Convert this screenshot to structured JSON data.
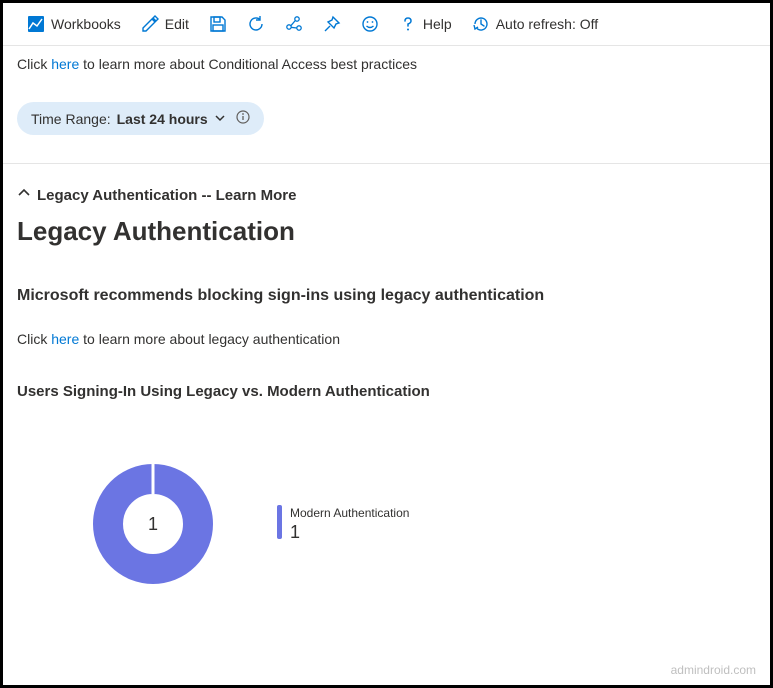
{
  "toolbar": {
    "workbooks": "Workbooks",
    "edit": "Edit",
    "help": "Help",
    "auto_refresh": "Auto refresh: Off"
  },
  "info_line": {
    "pre": "Click ",
    "link": "here",
    "post": " to learn more about Conditional Access best practices"
  },
  "time_range": {
    "label": "Time Range: ",
    "value": "Last 24 hours"
  },
  "section": {
    "expander_label": "Legacy Authentication -- Learn More",
    "title": "Legacy Authentication",
    "subtitle": "Microsoft recommends blocking sign-ins using legacy authentication",
    "body_pre": "Click ",
    "body_link": "here",
    "body_post": " to learn more about legacy authentication",
    "chart_title": "Users Signing-In Using Legacy vs. Modern Authentication"
  },
  "chart_data": {
    "type": "pie",
    "title": "Users Signing-In Using Legacy vs. Modern Authentication",
    "series": [
      {
        "name": "Modern Authentication",
        "value": 1,
        "color": "#6b75e3"
      }
    ],
    "center_value": "1"
  },
  "watermark": "admindroid.com"
}
